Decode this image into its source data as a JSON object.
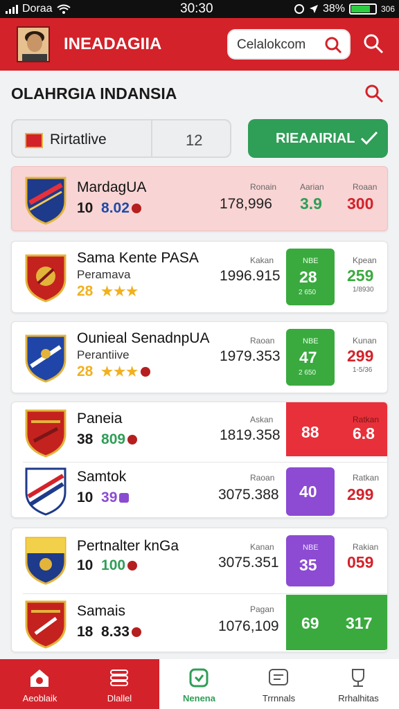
{
  "status_bar": {
    "carrier": "Doraa",
    "time": "30:30",
    "battery": "38%",
    "extra": "306"
  },
  "header": {
    "title": "INEADAGIIA",
    "search_value": "Celalokcom"
  },
  "section": {
    "title": "OLAHRGIA INDANSIA"
  },
  "filter": {
    "label": "Rirtatlive",
    "count": "12"
  },
  "action_button": {
    "label": "RIEAAIRIAL"
  },
  "colors": {
    "brand_red": "#d3222a",
    "green": "#3aaa3f",
    "red": "#e8303a",
    "purple": "#8c4bd2",
    "highlight": "#f9d4d4"
  },
  "rows": [
    {
      "name": "MardagUA",
      "stat_a": "10",
      "stat_b": "8.02",
      "label1": "Ronain",
      "value1": "178,996",
      "label2": "Aarian",
      "col1": "3.9",
      "label3": "Roaan",
      "col2": "300"
    },
    {
      "name": "Sama Kente PASA",
      "sub": "Peramava",
      "rank": "28",
      "stars": "★★★",
      "label1": "Kakan",
      "value1": "1996.915",
      "box_top": "NBE",
      "col1": "28",
      "box_bottom": "2 650",
      "label3": "Kpean",
      "col2": "259",
      "sub3": "1/8930"
    },
    {
      "name": "Ounieal SenadnpUA",
      "sub": "Perantiive",
      "rank": "28",
      "stars": "★★★",
      "label1": "Raoan",
      "value1": "1979.353",
      "box_top": "NBE",
      "col1": "47",
      "box_bottom": "2 650",
      "label3": "Kunan",
      "col2": "299",
      "sub3": "1-5/36"
    },
    {
      "name": "Paneia",
      "stat_a": "38",
      "stat_b": "809",
      "label1": "Askan",
      "value1": "1819.358",
      "col1": "88",
      "label3": "Ratkan",
      "col2": "6.8"
    },
    {
      "name": "Samtok",
      "stat_a": "10",
      "stat_b": "39",
      "label1": "Raoan",
      "value1": "3075.388",
      "col1": "40",
      "label3": "Ratkan",
      "col2": "299"
    },
    {
      "name": "Pertnalter knGa",
      "stat_a": "10",
      "stat_b": "100",
      "label1": "Kanan",
      "value1": "3075.351",
      "box_top": "NBE",
      "col1": "35",
      "label3": "Rakian",
      "col2": "059"
    },
    {
      "name": "Samais",
      "stat_a": "18",
      "stat_b": "8.33",
      "label1": "Pagan",
      "value1": "1076,109",
      "col1": "69",
      "col2": "317"
    }
  ],
  "nav": [
    {
      "label": "Aeoblaik",
      "icon": "home-icon"
    },
    {
      "label": "Dlallel",
      "icon": "stack-icon"
    },
    {
      "label": "Nenena",
      "icon": "shield-icon"
    },
    {
      "label": "Trrnnals",
      "icon": "chat-icon"
    },
    {
      "label": "Rrhalhitas",
      "icon": "trophy-icon"
    }
  ]
}
